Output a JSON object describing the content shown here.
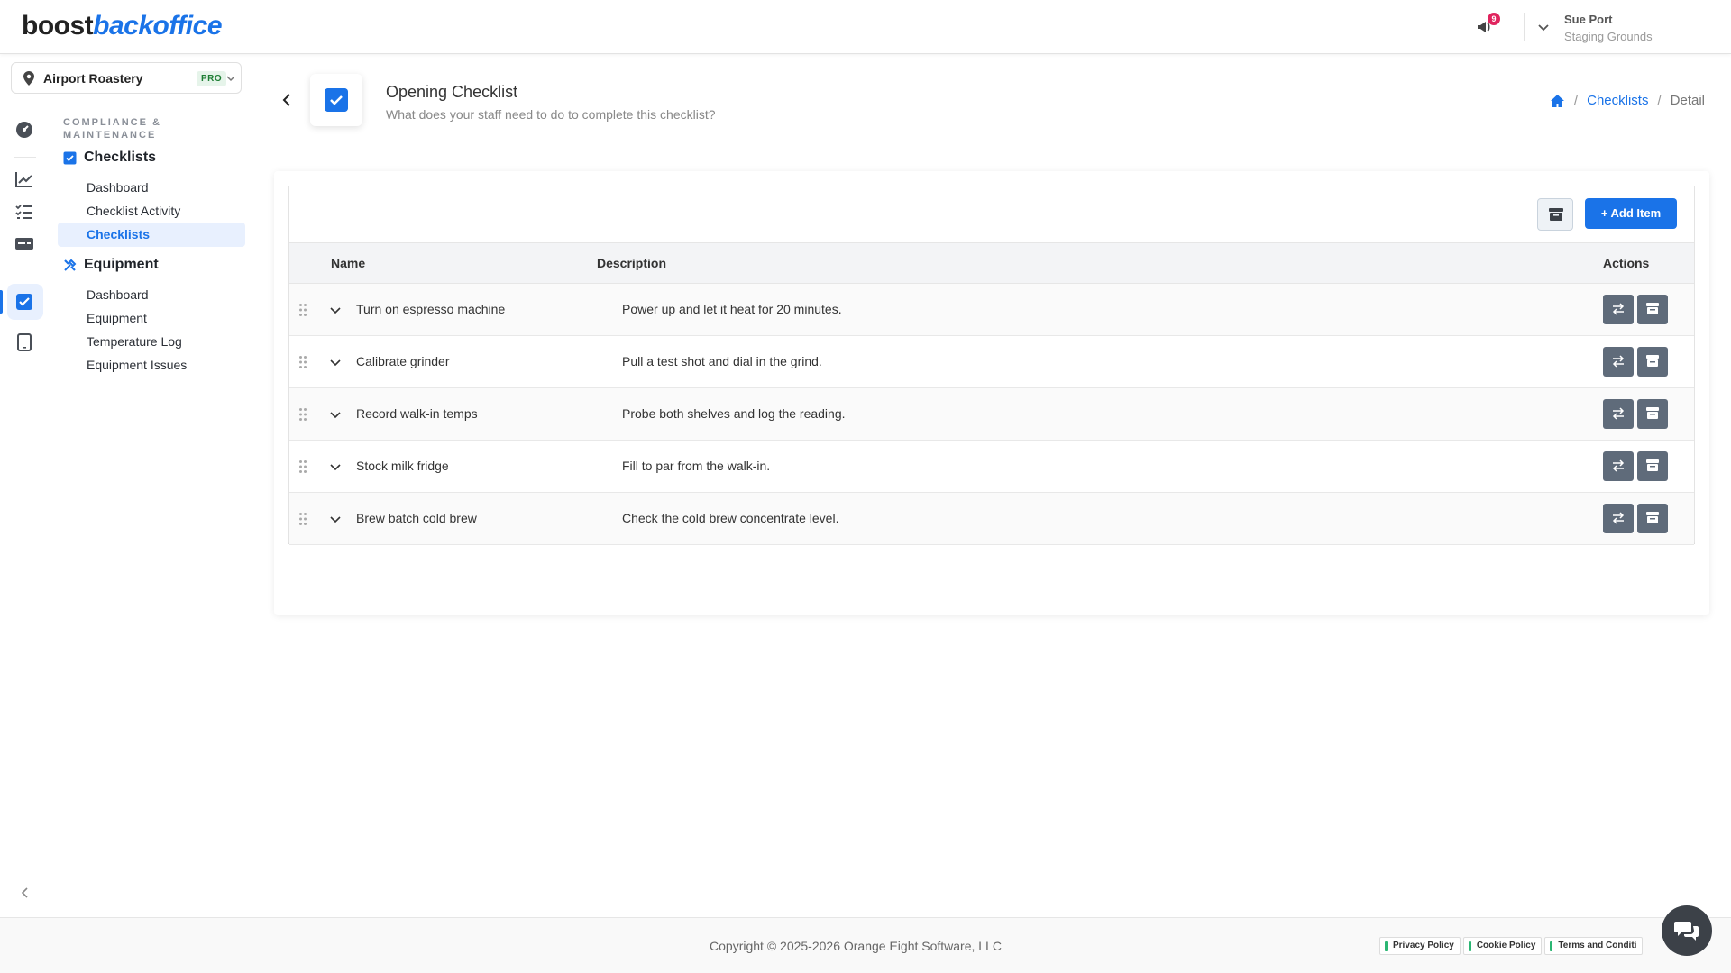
{
  "brand": {
    "logo_part1": "boost",
    "logo_part2": "backoffice"
  },
  "header": {
    "notification_count": "9",
    "user_name": "Sue Port",
    "user_org": "Staging Grounds"
  },
  "location": {
    "name": "Airport Roastery",
    "badge": "PRO"
  },
  "sidebar": {
    "section_title": "COMPLIANCE & MAINTENANCE",
    "groups": [
      {
        "title": "Checklists",
        "icon": "checkbox-icon",
        "items": [
          {
            "label": "Dashboard",
            "active": false
          },
          {
            "label": "Checklist Activity",
            "active": false
          },
          {
            "label": "Checklists",
            "active": true
          }
        ]
      },
      {
        "title": "Equipment",
        "icon": "tools-icon",
        "items": [
          {
            "label": "Dashboard",
            "active": false
          },
          {
            "label": "Equipment",
            "active": false
          },
          {
            "label": "Temperature Log",
            "active": false
          },
          {
            "label": "Equipment Issues",
            "active": false
          }
        ]
      }
    ]
  },
  "rail": {
    "icons": [
      "dashboard-gauge-icon",
      "chart-line-icon",
      "task-list-icon",
      "card-icon",
      "checkbox-icon",
      "tablet-icon"
    ],
    "active_index": 4
  },
  "page": {
    "title": "Opening Checklist",
    "subtitle": "What does your staff need to do to complete this checklist?",
    "breadcrumb": {
      "link": "Checklists",
      "current": "Detail"
    }
  },
  "toolbar": {
    "add_label": "Add Item"
  },
  "table": {
    "columns": {
      "name": "Name",
      "description": "Description",
      "actions": "Actions"
    },
    "rows": [
      {
        "name": "Turn on espresso machine",
        "description": "Power up and let it heat for 20 minutes."
      },
      {
        "name": "Calibrate grinder",
        "description": "Pull a test shot and dial in the grind."
      },
      {
        "name": "Record walk-in temps",
        "description": "Probe both shelves and log the reading."
      },
      {
        "name": "Stock milk fridge",
        "description": "Fill to par from the walk-in."
      },
      {
        "name": "Brew batch cold brew",
        "description": "Check the cold brew concentrate level."
      }
    ]
  },
  "footer": {
    "copyright": "Copyright © 2025-2026 Orange Eight Software, LLC",
    "links": [
      "Privacy Policy",
      "Cookie Policy",
      "Terms and Conditi"
    ]
  },
  "colors": {
    "accent": "#1a73e8",
    "action_button": "#5f6b7a",
    "badge": "#e0245e"
  }
}
